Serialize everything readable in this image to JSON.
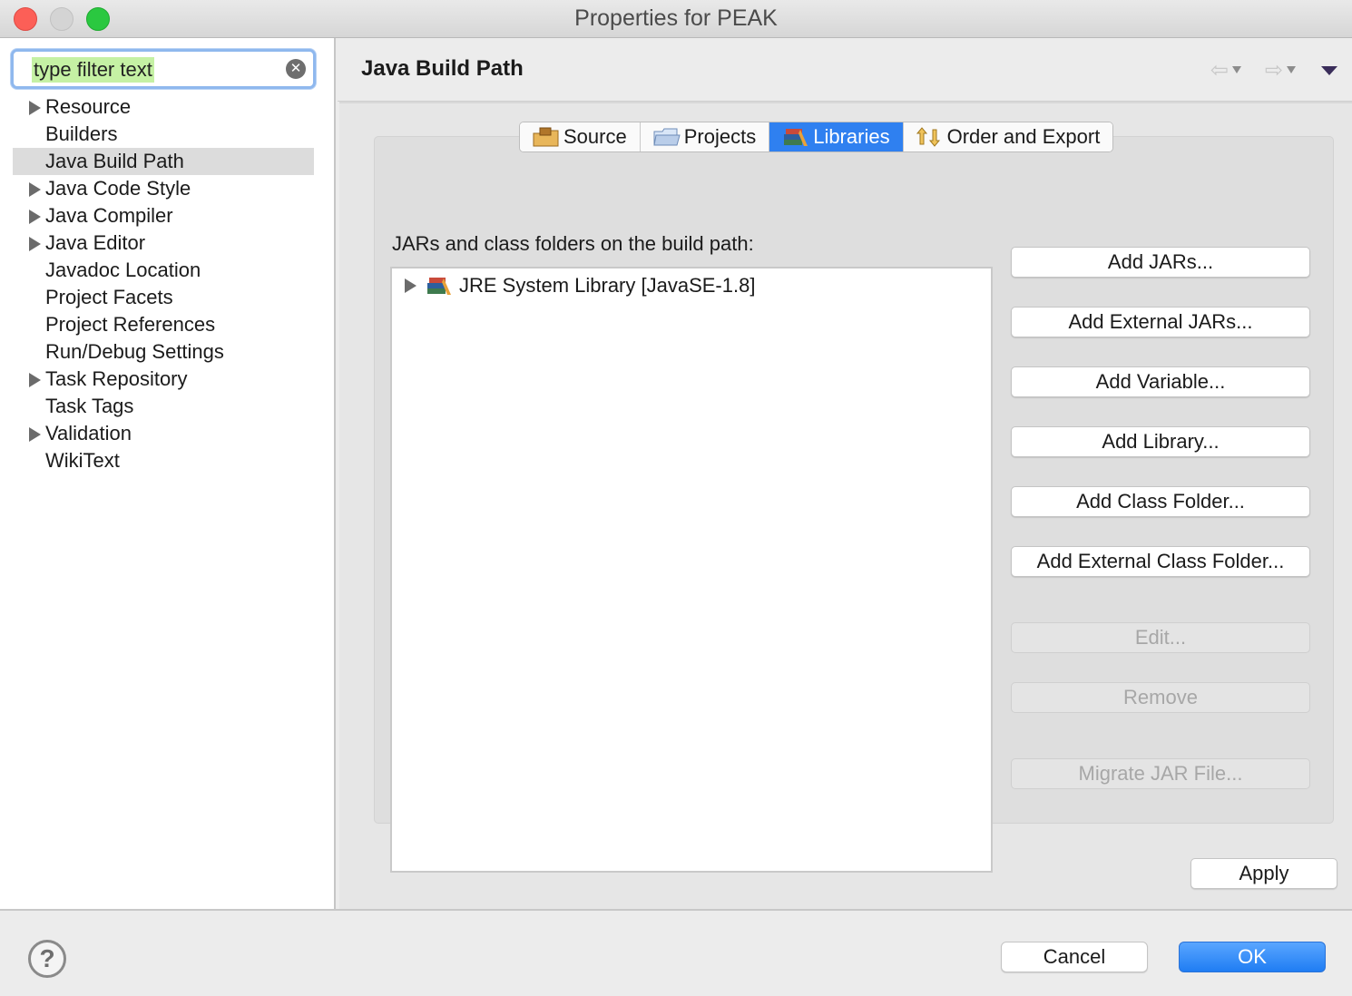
{
  "window": {
    "title": "Properties for PEAK"
  },
  "sidebar": {
    "filter_placeholder": "type filter text",
    "items": [
      {
        "label": "Resource",
        "expandable": true,
        "selected": false
      },
      {
        "label": "Builders",
        "expandable": false,
        "selected": false
      },
      {
        "label": "Java Build Path",
        "expandable": false,
        "selected": true
      },
      {
        "label": "Java Code Style",
        "expandable": true,
        "selected": false
      },
      {
        "label": "Java Compiler",
        "expandable": true,
        "selected": false
      },
      {
        "label": "Java Editor",
        "expandable": true,
        "selected": false
      },
      {
        "label": "Javadoc Location",
        "expandable": false,
        "selected": false
      },
      {
        "label": "Project Facets",
        "expandable": false,
        "selected": false
      },
      {
        "label": "Project References",
        "expandable": false,
        "selected": false
      },
      {
        "label": "Run/Debug Settings",
        "expandable": false,
        "selected": false
      },
      {
        "label": "Task Repository",
        "expandable": true,
        "selected": false
      },
      {
        "label": "Task Tags",
        "expandable": false,
        "selected": false
      },
      {
        "label": "Validation",
        "expandable": true,
        "selected": false
      },
      {
        "label": "WikiText",
        "expandable": false,
        "selected": false
      }
    ]
  },
  "main": {
    "page_title": "Java Build Path",
    "tabs": [
      {
        "label": "Source",
        "icon": "source-folder-icon",
        "active": false
      },
      {
        "label": "Projects",
        "icon": "projects-folder-icon",
        "active": false
      },
      {
        "label": "Libraries",
        "icon": "libraries-icon",
        "active": true
      },
      {
        "label": "Order and Export",
        "icon": "order-export-icon",
        "active": false
      }
    ],
    "section_label": "JARs and class folders on the build path:",
    "libraries": [
      {
        "label": "JRE System Library [JavaSE-1.8]",
        "icon": "jre-library-icon"
      }
    ],
    "buttons": {
      "add_jars": "Add JARs...",
      "add_external_jars": "Add External JARs...",
      "add_variable": "Add Variable...",
      "add_library": "Add Library...",
      "add_class_folder": "Add Class Folder...",
      "add_external_class_folder": "Add External Class Folder...",
      "edit": "Edit...",
      "remove": "Remove",
      "migrate_jar": "Migrate JAR File..."
    },
    "apply_label": "Apply"
  },
  "footer": {
    "help_glyph": "?",
    "cancel_label": "Cancel",
    "ok_label": "OK"
  },
  "colors": {
    "accent": "#2f80f0",
    "selection": "#dcdcdc",
    "filter_highlight": "#c5f1a4"
  }
}
